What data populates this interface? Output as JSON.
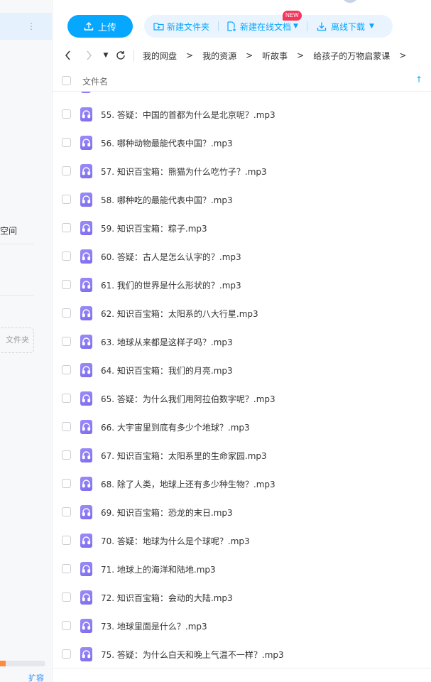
{
  "sidebar": {
    "space_label": "空间",
    "folder_button_label": "文件夹",
    "storage_used_fraction": 0.12,
    "expand_label": "扩容"
  },
  "toolbar": {
    "upload_label": "上传",
    "new_folder_label": "新建文件夹",
    "new_online_doc_label": "新建在线文档",
    "new_badge": "NEW",
    "offline_download_label": "离线下载"
  },
  "breadcrumb": [
    "我的网盘",
    "我的资源",
    "听故事",
    "给孩子的万物启蒙课"
  ],
  "list": {
    "header_name": "文件名",
    "files": [
      "55. 答疑：中国的首都为什么是北京呢？.mp3",
      "56. 哪种动物最能代表中国？.mp3",
      "57. 知识百宝箱：熊猫为什么吃竹子？.mp3",
      "58. 哪种吃的最能代表中国？.mp3",
      "59. 知识百宝箱：粽子.mp3",
      "60. 答疑：古人是怎么认字的？.mp3",
      "61. 我们的世界是什么形状的？.mp3",
      "62. 知识百宝箱：太阳系的八大行星.mp3",
      "63. 地球从来都是这样子吗？.mp3",
      "64. 知识百宝箱：我们的月亮.mp3",
      "65. 答疑：为什么我们用阿拉伯数字呢？.mp3",
      "66. 大宇宙里到底有多少个地球？.mp3",
      "67. 知识百宝箱：太阳系里的生命家园.mp3",
      "68. 除了人类，地球上还有多少种生物？.mp3",
      "69. 知识百宝箱：恐龙的末日.mp3",
      "70. 答疑：地球为什么是个球呢？.mp3",
      "71. 地球上的海洋和陆地.mp3",
      "72. 知识百宝箱：会动的大陆.mp3",
      "73. 地球里面是什么？.mp3",
      "75. 答疑：为什么白天和晚上气温不一样？.mp3"
    ]
  },
  "colors": {
    "accent": "#06a7ff",
    "file_icon": "#8b7cf6",
    "badge": "#f5365c",
    "storage": "#ff8a3d"
  },
  "icons": {
    "upload": "upload-icon",
    "new_folder": "folder-plus-icon",
    "online_doc": "document-plus-icon",
    "offline_download": "download-icon",
    "file": "headphones-icon",
    "back": "chevron-left-icon",
    "forward": "chevron-right-icon",
    "refresh": "refresh-icon",
    "sort": "arrow-up-icon"
  }
}
